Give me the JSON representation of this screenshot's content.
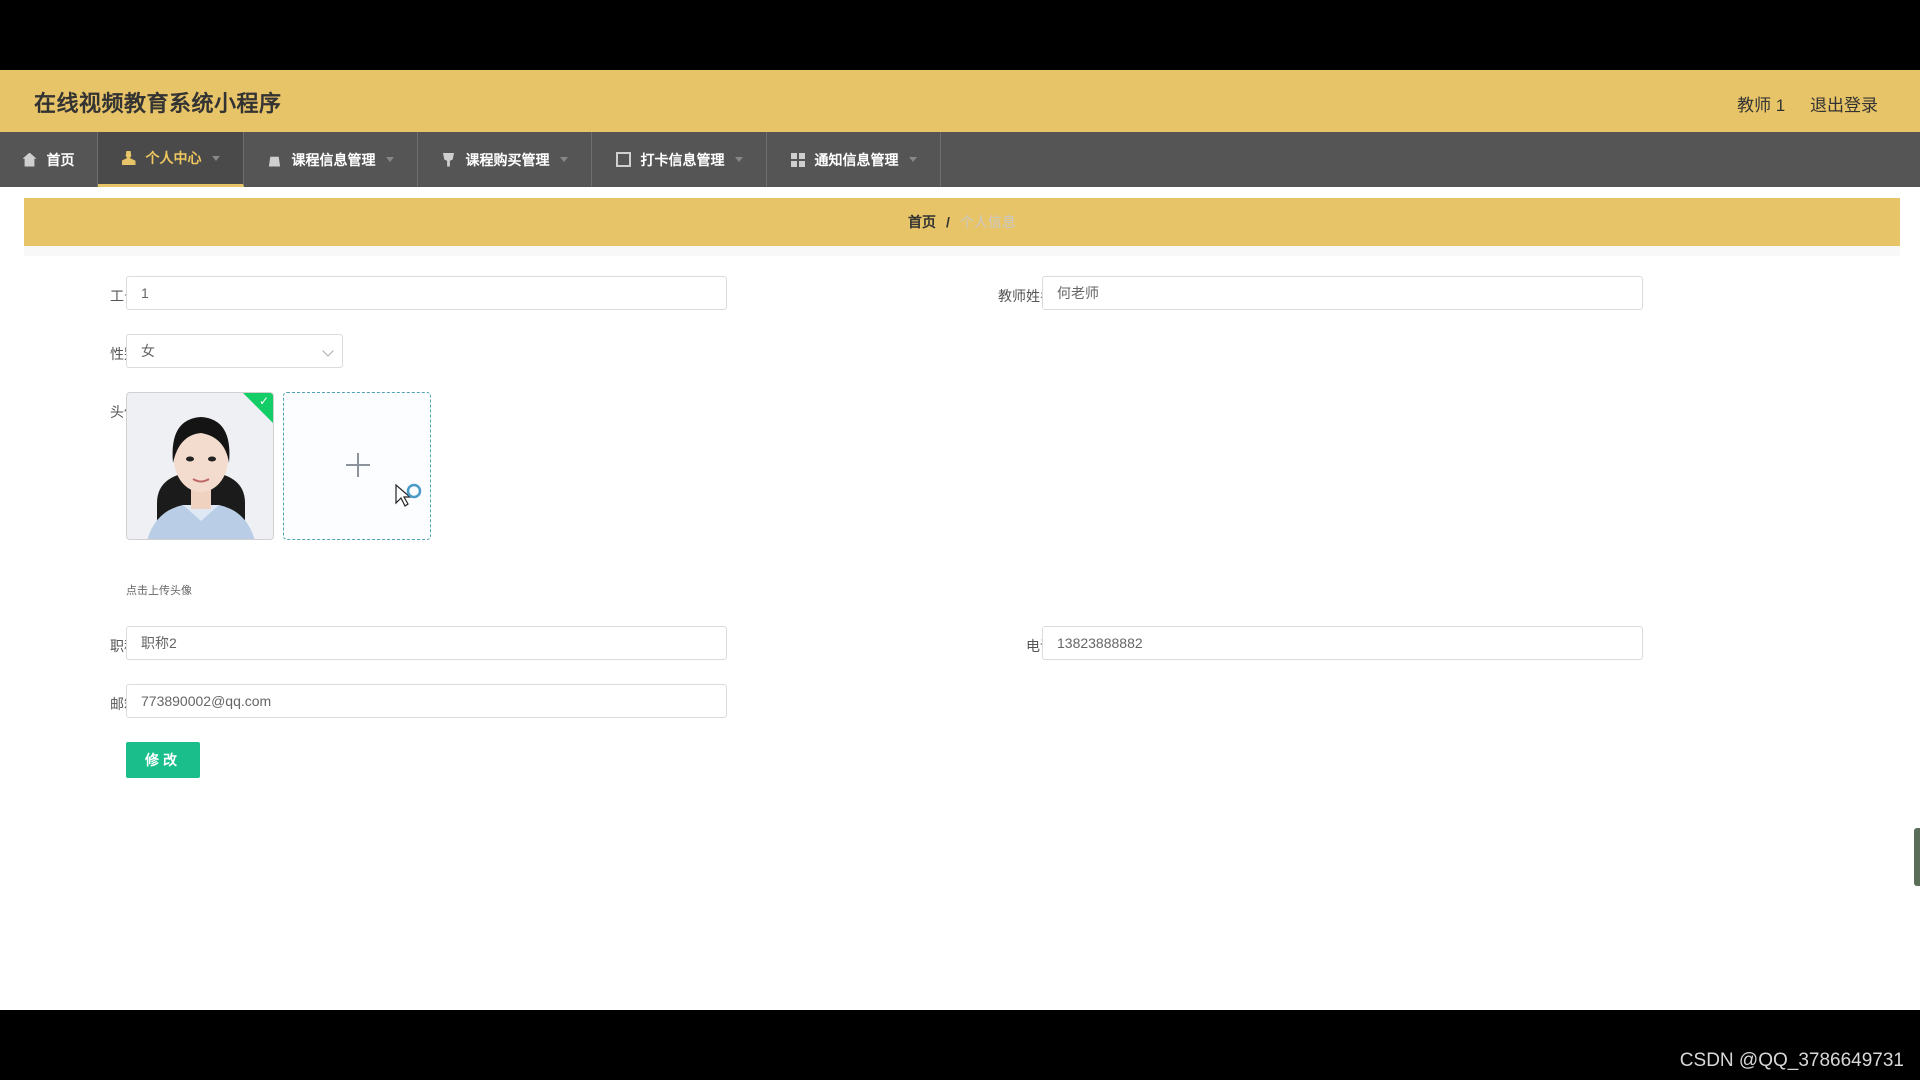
{
  "app": {
    "title": "在线视频教育系统小程序"
  },
  "header": {
    "user": "教师 1",
    "logout": "退出登录"
  },
  "nav": {
    "items": [
      {
        "label": "首页",
        "icon": "home-icon"
      },
      {
        "label": "个人中心",
        "icon": "user-icon",
        "active": true
      },
      {
        "label": "课程信息管理",
        "icon": "bag-icon"
      },
      {
        "label": "课程购买管理",
        "icon": "cup-icon"
      },
      {
        "label": "打卡信息管理",
        "icon": "copy-icon"
      },
      {
        "label": "通知信息管理",
        "icon": "grid-icon"
      }
    ]
  },
  "breadcrumb": {
    "home": "首页",
    "separator": "/",
    "current": "个人信息"
  },
  "form": {
    "employee_id": {
      "label": "工号",
      "value": "1"
    },
    "teacher_name": {
      "label": "教师姓名",
      "value": "何老师"
    },
    "gender": {
      "label": "性别",
      "value": "女"
    },
    "avatar": {
      "label": "头像",
      "hint": "点击上传头像"
    },
    "title": {
      "label": "职称",
      "value": "职称2"
    },
    "phone": {
      "label": "电话",
      "value": "13823888882"
    },
    "email": {
      "label": "邮箱",
      "value": "773890002@qq.com"
    },
    "submit_label": "修改"
  },
  "watermark": "CSDN @QQ_3786649731",
  "colors": {
    "header": "#e8c468",
    "nav": "#555555",
    "button": "#19be8b",
    "success": "#13ce66"
  }
}
